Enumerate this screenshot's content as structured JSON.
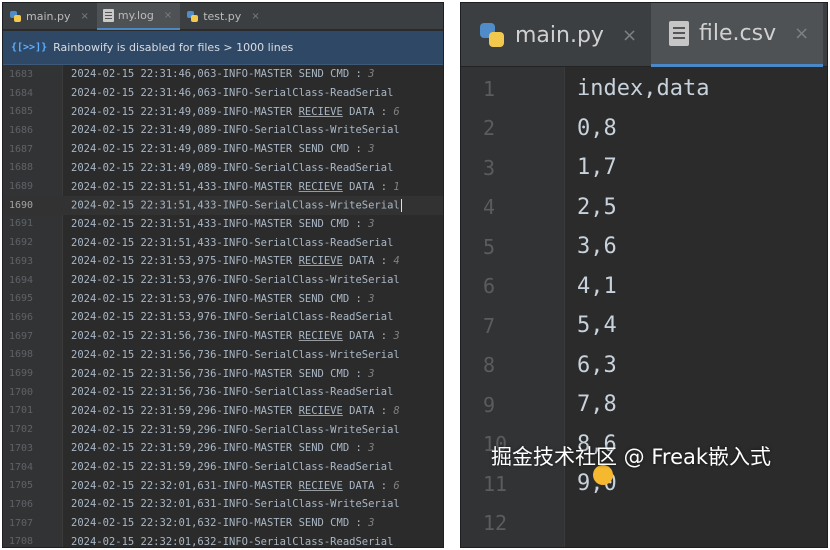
{
  "left_editor": {
    "tabs": [
      {
        "label": "main.py",
        "close": "×",
        "icon": "python-file-icon"
      },
      {
        "label": "my.log",
        "close": "×",
        "icon": "log-file-icon"
      },
      {
        "label": "test.py",
        "close": "×",
        "icon": "python-file-icon"
      }
    ],
    "banner": {
      "icon": "{[>>]}",
      "text": "Rainbowify is disabled for files > 1000 lines"
    },
    "lines": [
      {
        "n": "1683",
        "prefix": "2024-02-15 22:31:46,063-INFO-MASTER SEND CMD : ",
        "value": "3"
      },
      {
        "n": "1684",
        "prefix": "2024-02-15 22:31:46,063-INFO-SerialClass-ReadSerial",
        "value": ""
      },
      {
        "n": "1685",
        "prefix": "2024-02-15 22:31:49,089-INFO-MASTER ",
        "ul": "RECIEVE",
        "suffix": " DATA : ",
        "value": "6"
      },
      {
        "n": "1686",
        "prefix": "2024-02-15 22:31:49,089-INFO-SerialClass-WriteSerial",
        "value": ""
      },
      {
        "n": "1687",
        "prefix": "2024-02-15 22:31:49,089-INFO-MASTER SEND CMD : ",
        "value": "3"
      },
      {
        "n": "1688",
        "prefix": "2024-02-15 22:31:49,089-INFO-SerialClass-ReadSerial",
        "value": ""
      },
      {
        "n": "1689",
        "prefix": "2024-02-15 22:31:51,433-INFO-MASTER ",
        "ul": "RECIEVE",
        "suffix": " DATA : ",
        "value": "1"
      },
      {
        "n": "1690",
        "prefix": "2024-02-15 22:31:51,433-INFO-SerialClass-WriteSerial",
        "value": "",
        "current": true
      },
      {
        "n": "1691",
        "prefix": "2024-02-15 22:31:51,433-INFO-MASTER SEND CMD : ",
        "value": "3"
      },
      {
        "n": "1692",
        "prefix": "2024-02-15 22:31:51,433-INFO-SerialClass-ReadSerial",
        "value": ""
      },
      {
        "n": "1693",
        "prefix": "2024-02-15 22:31:53,975-INFO-MASTER ",
        "ul": "RECIEVE",
        "suffix": " DATA : ",
        "value": "4"
      },
      {
        "n": "1694",
        "prefix": "2024-02-15 22:31:53,976-INFO-SerialClass-WriteSerial",
        "value": ""
      },
      {
        "n": "1695",
        "prefix": "2024-02-15 22:31:53,976-INFO-MASTER SEND CMD : ",
        "value": "3"
      },
      {
        "n": "1696",
        "prefix": "2024-02-15 22:31:53,976-INFO-SerialClass-ReadSerial",
        "value": ""
      },
      {
        "n": "1697",
        "prefix": "2024-02-15 22:31:56,736-INFO-MASTER ",
        "ul": "RECIEVE",
        "suffix": " DATA : ",
        "value": "3"
      },
      {
        "n": "1698",
        "prefix": "2024-02-15 22:31:56,736-INFO-SerialClass-WriteSerial",
        "value": ""
      },
      {
        "n": "1699",
        "prefix": "2024-02-15 22:31:56,736-INFO-MASTER SEND CMD : ",
        "value": "3"
      },
      {
        "n": "1700",
        "prefix": "2024-02-15 22:31:56,736-INFO-SerialClass-ReadSerial",
        "value": ""
      },
      {
        "n": "1701",
        "prefix": "2024-02-15 22:31:59,296-INFO-MASTER ",
        "ul": "RECIEVE",
        "suffix": " DATA : ",
        "value": "8"
      },
      {
        "n": "1702",
        "prefix": "2024-02-15 22:31:59,296-INFO-SerialClass-WriteSerial",
        "value": ""
      },
      {
        "n": "1703",
        "prefix": "2024-02-15 22:31:59,296-INFO-MASTER SEND CMD : ",
        "value": "3"
      },
      {
        "n": "1704",
        "prefix": "2024-02-15 22:31:59,296-INFO-SerialClass-ReadSerial",
        "value": ""
      },
      {
        "n": "1705",
        "prefix": "2024-02-15 22:32:01,631-INFO-MASTER ",
        "ul": "RECIEVE",
        "suffix": " DATA : ",
        "value": "6"
      },
      {
        "n": "1706",
        "prefix": "2024-02-15 22:32:01,631-INFO-SerialClass-WriteSerial",
        "value": ""
      },
      {
        "n": "1707",
        "prefix": "2024-02-15 22:32:01,632-INFO-MASTER SEND CMD : ",
        "value": "3"
      },
      {
        "n": "1708",
        "prefix": "2024-02-15 22:32:01,632-INFO-SerialClass-ReadSerial",
        "value": ""
      }
    ]
  },
  "right_editor": {
    "tabs": [
      {
        "label": "main.py",
        "close": "×",
        "icon": "python-file-icon"
      },
      {
        "label": "file.csv",
        "close": "×",
        "icon": "csv-file-icon"
      }
    ],
    "lines": [
      {
        "n": "1",
        "text": "index,data"
      },
      {
        "n": "2",
        "text": "0,8"
      },
      {
        "n": "3",
        "text": "1,7"
      },
      {
        "n": "4",
        "text": "2,5"
      },
      {
        "n": "5",
        "text": "3,6"
      },
      {
        "n": "6",
        "text": "4,1"
      },
      {
        "n": "7",
        "text": "5,4"
      },
      {
        "n": "8",
        "text": "6,3"
      },
      {
        "n": "9",
        "text": "7,8"
      },
      {
        "n": "10",
        "text": "8,6"
      },
      {
        "n": "11",
        "text": "9,0"
      },
      {
        "n": "12",
        "text": ""
      }
    ],
    "intention_bulb": "lightbulb-icon"
  },
  "watermark": "掘金技术社区 @ Freak嵌入式",
  "colors": {
    "accent": "#4a88c7",
    "banner_bg": "#2f4865",
    "editor_bg": "#2b2b2b",
    "bulb": "#f5b82e"
  }
}
